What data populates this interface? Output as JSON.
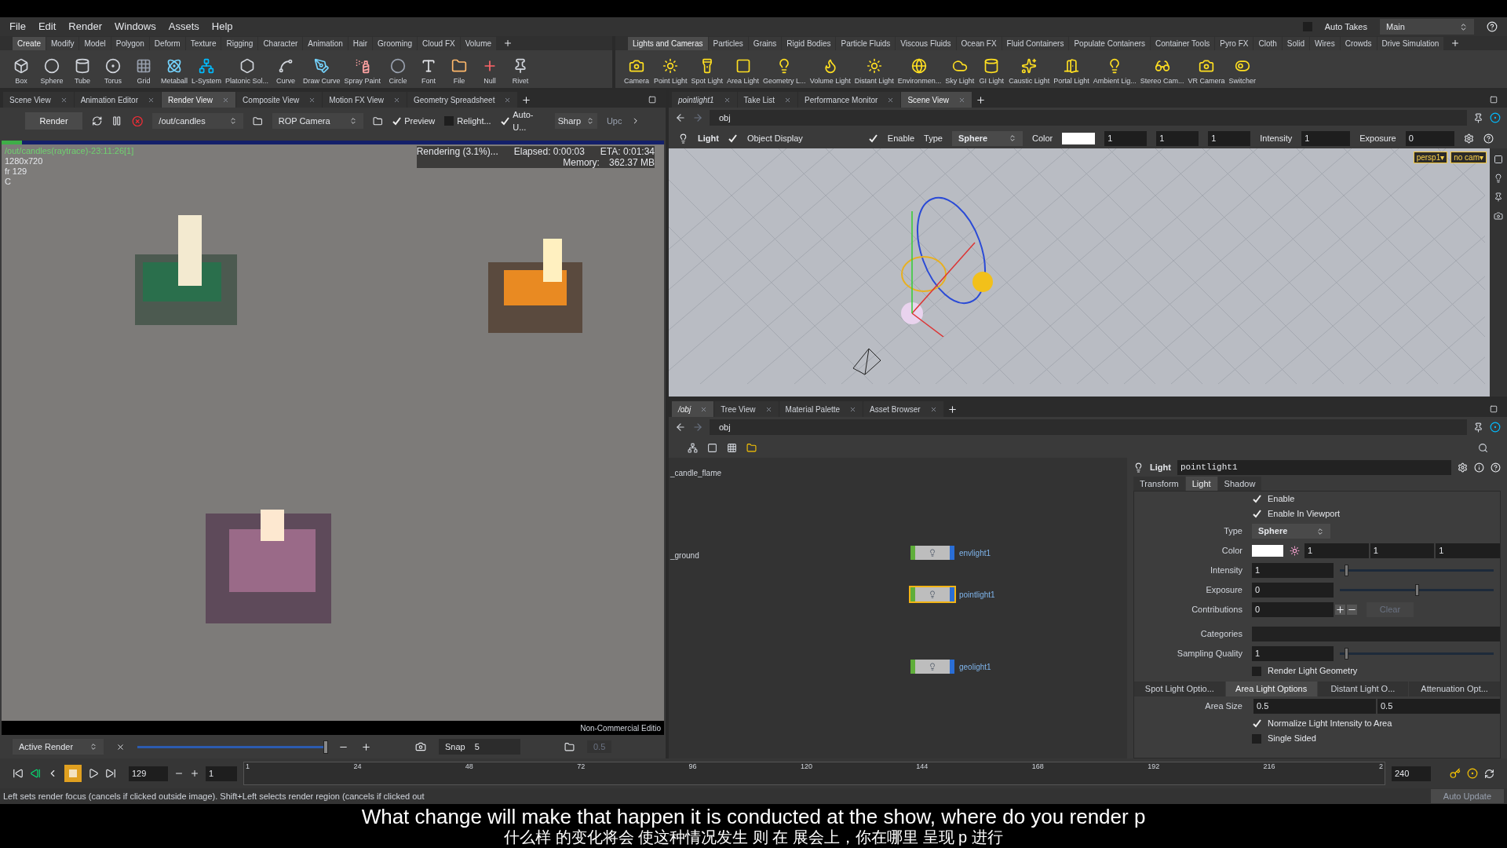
{
  "menu": [
    "File",
    "Edit",
    "Render",
    "Windows",
    "Assets",
    "Help"
  ],
  "top_right": {
    "auto_takes": {
      "label": "Auto Takes",
      "checked": false
    },
    "take": "Main"
  },
  "shelf_left": {
    "tabs": [
      {
        "label": "Create",
        "selected": true
      },
      {
        "label": "Modify",
        "selected": false
      },
      {
        "label": "Model",
        "selected": false
      },
      {
        "label": "Polygon",
        "selected": false
      },
      {
        "label": "Deform",
        "selected": false
      },
      {
        "label": "Texture",
        "selected": false
      },
      {
        "label": "Rigging",
        "selected": false
      },
      {
        "label": "Character",
        "selected": false
      },
      {
        "label": "Animation",
        "selected": false
      },
      {
        "label": "Hair",
        "selected": false
      },
      {
        "label": "Grooming",
        "selected": false
      },
      {
        "label": "Cloud FX",
        "selected": false
      },
      {
        "label": "Volume",
        "selected": false
      }
    ],
    "tools": [
      "Box",
      "Sphere",
      "Tube",
      "Torus",
      "Grid",
      "Metaball",
      "L-System",
      "Platonic Sol...",
      "Curve",
      "Draw Curve",
      "Spray Paint",
      "Circle",
      "Font",
      "File",
      "Null",
      "Rivet"
    ]
  },
  "shelf_right": {
    "tabs": [
      {
        "label": "Lights and Cameras",
        "selected": true
      },
      {
        "label": "Particles",
        "selected": false
      },
      {
        "label": "Grains",
        "selected": false
      },
      {
        "label": "Rigid Bodies",
        "selected": false
      },
      {
        "label": "Particle Fluids",
        "selected": false
      },
      {
        "label": "Viscous Fluids",
        "selected": false
      },
      {
        "label": "Ocean FX",
        "selected": false
      },
      {
        "label": "Fluid Containers",
        "selected": false
      },
      {
        "label": "Populate Containers",
        "selected": false
      },
      {
        "label": "Container Tools",
        "selected": false
      },
      {
        "label": "Pyro FX",
        "selected": false
      },
      {
        "label": "Cloth",
        "selected": false
      },
      {
        "label": "Solid",
        "selected": false
      },
      {
        "label": "Wires",
        "selected": false
      },
      {
        "label": "Crowds",
        "selected": false
      },
      {
        "label": "Drive Simulation",
        "selected": false
      }
    ],
    "tools": [
      "Camera",
      "Point Light",
      "Spot Light",
      "Area Light",
      "Geometry L...",
      "Volume Light",
      "Distant Light",
      "Environmen...",
      "Sky Light",
      "GI Light",
      "Caustic Light",
      "Portal Light",
      "Ambient Lig...",
      "Stereo Cam...",
      "VR Camera",
      "Switcher"
    ]
  },
  "render_view": {
    "tabs": [
      {
        "label": "Scene View",
        "selected": false
      },
      {
        "label": "Animation Editor",
        "selected": false
      },
      {
        "label": "Render View",
        "selected": true
      },
      {
        "label": "Composite View",
        "selected": false
      },
      {
        "label": "Motion FX View",
        "selected": false
      },
      {
        "label": "Geometry Spreadsheet",
        "selected": false
      }
    ],
    "render_button": "Render",
    "output": "/out/candles",
    "camera": "ROP Camera",
    "options": [
      {
        "label": "Preview",
        "checked": true
      },
      {
        "label": "Relight...",
        "checked": false
      },
      {
        "label": "Auto-U...",
        "checked": true
      }
    ],
    "filter": "Sharp",
    "more": "Upc",
    "progress": {
      "level": 0.031
    },
    "info": {
      "name": "/out/candles(raytrace)-23:11:26[1]",
      "resolution": "1280x720",
      "frame": "fr 129",
      "channel": "C",
      "status": "Rendering (3.1%)...",
      "elapsed": "Elapsed: 0:00:03",
      "eta": "ETA: 0:01:34",
      "memory_label": "Memory:",
      "memory": "362.37 MB"
    },
    "edition": "Non-Commercial Editio",
    "bottom": {
      "mode": "Active Render",
      "zoom": {
        "level": 1
      },
      "snap_label": "Snap",
      "snap": "5",
      "value": "0.5"
    }
  },
  "scene_view": {
    "tabs": [
      {
        "label": "pointlight1",
        "selected": false
      },
      {
        "label": "Take List",
        "selected": false
      },
      {
        "label": "Performance Monitor",
        "selected": false
      },
      {
        "label": "Scene View",
        "selected": true
      }
    ],
    "path": "obj",
    "light_bar": {
      "label": "Light",
      "object_display": {
        "label": "Object Display",
        "checked": true
      },
      "enable": {
        "label": "Enable",
        "checked": true
      },
      "type_label": "Type",
      "type": "Sphere",
      "color_label": "Color",
      "rgb": [
        "1",
        "1",
        "1"
      ],
      "intensity_label": "Intensity",
      "intensity": "1",
      "exposure_label": "Exposure",
      "exposure": "0"
    },
    "view_menus": [
      "persp1▾",
      "no cam▾"
    ]
  },
  "network": {
    "tabs": [
      {
        "label": "/obj",
        "selected": true
      },
      {
        "label": "Tree View",
        "selected": false
      },
      {
        "label": "Material Palette",
        "selected": false
      },
      {
        "label": "Asset Browser",
        "selected": false
      }
    ],
    "path": "obj",
    "labels": [
      "_candle_flame",
      "_ground"
    ],
    "nodes": [
      {
        "name": "envlight1",
        "selected": false
      },
      {
        "name": "pointlight1",
        "selected": true
      },
      {
        "name": "geolight1",
        "selected": false
      }
    ]
  },
  "parameters": {
    "kind_label": "Light",
    "node": "pointlight1",
    "tabs": [
      {
        "label": "Transform",
        "selected": false
      },
      {
        "label": "Light",
        "selected": true
      },
      {
        "label": "Shadow",
        "selected": false
      }
    ],
    "enable": {
      "label": "Enable",
      "checked": true
    },
    "enable_viewport": {
      "label": "Enable In Viewport",
      "checked": true
    },
    "type_label": "Type",
    "type": "Sphere",
    "color_label": "Color",
    "rgb": [
      "1",
      "1",
      "1"
    ],
    "intensity": {
      "label": "Intensity",
      "value": "1",
      "level": 0.04
    },
    "exposure": {
      "label": "Exposure",
      "value": "0",
      "level": 0.5
    },
    "contributions": {
      "label": "Contributions",
      "value": "0",
      "clear": "Clear"
    },
    "categories_label": "Categories",
    "sampling": {
      "label": "Sampling Quality",
      "value": "1",
      "level": 0.04
    },
    "render_geometry": {
      "label": "Render Light Geometry",
      "checked": false
    },
    "subtabs": [
      {
        "label": "Spot Light Optio...",
        "selected": false
      },
      {
        "label": "Area Light Options",
        "selected": true
      },
      {
        "label": "Distant Light O...",
        "selected": false
      },
      {
        "label": "Attenuation Opt...",
        "selected": false
      }
    ],
    "area_size_label": "Area Size",
    "area_size": [
      "0.5",
      "0.5"
    ],
    "normalize": {
      "label": "Normalize Light Intensity to Area",
      "checked": true
    },
    "single_sided": {
      "label": "Single Sided",
      "checked": false
    }
  },
  "timeline": {
    "frame": "129",
    "step": "1",
    "ticks": [
      "1",
      "24",
      "48",
      "72",
      "96",
      "120",
      "144",
      "168",
      "192",
      "216",
      "2"
    ],
    "end": "240"
  },
  "status_bar": {
    "message": "Left sets render focus (cancels if clicked outside image). Shift+Left selects render region (cancels if clicked out",
    "auto_update": "Auto Update"
  },
  "subtitles": [
    "What change will make that happen it is conducted at the show, where do you render p",
    "什么样 的变化将会 使这种情况发生 则 在 展会上，你在哪里 呈现 p 进行"
  ]
}
